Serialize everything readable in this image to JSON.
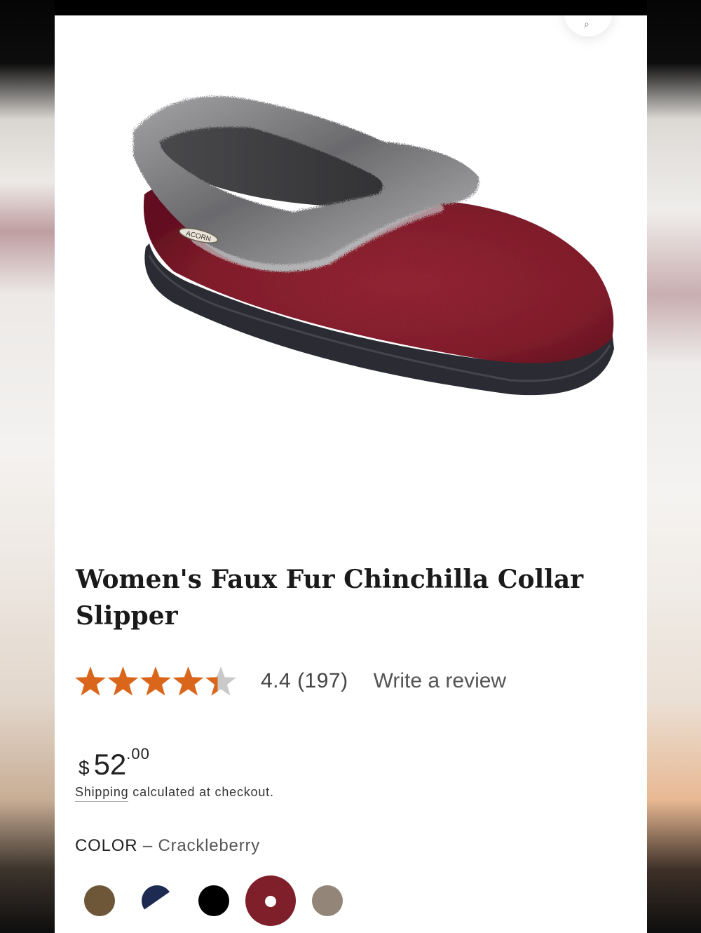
{
  "product": {
    "title": "Women's Faux Fur Chinchilla Collar Slipper",
    "rating_value": "4.4",
    "rating_count": "(197)",
    "rating_stars": 4.4,
    "write_review": "Write a review",
    "price_currency": "$",
    "price_main": "52",
    "price_cents": ".00",
    "shipping_link": "Shipping",
    "shipping_rest": " calculated at checkout.",
    "color_label": "COLOR",
    "color_dash": " – ",
    "color_value": "Crackleberry",
    "image_logo": "ACORN"
  },
  "colors": {
    "star": "#d9661b",
    "star_empty": "#c9c9c9",
    "swatches": [
      "#6e5638",
      "#1d2b52",
      "#000000",
      "#7f1f2a",
      "#938679"
    ]
  },
  "icons": [
    "zoom-icon",
    "star-icon"
  ]
}
